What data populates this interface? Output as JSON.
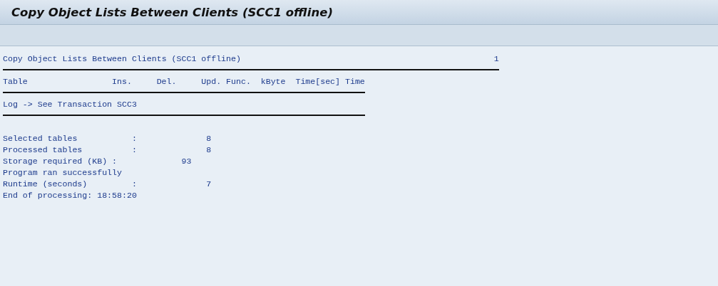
{
  "window": {
    "title": "Copy Object Lists Between Clients (SCC1 offline)"
  },
  "report": {
    "title": "Copy Object Lists Between Clients (SCC1 offline)",
    "page": "1",
    "columns": [
      "Table",
      "Ins.",
      "Del.",
      "Upd.",
      "Func.",
      "kByte",
      "Time[sec]",
      "Time"
    ],
    "log_note": "Log -> See Transaction SCC3",
    "lines": [
      {
        "kind": "stat",
        "label": "Selected tables",
        "colon": ":",
        "value": "8"
      },
      {
        "kind": "stat",
        "label": "Processed tables",
        "colon": ":",
        "value": "8"
      },
      {
        "kind": "storage",
        "label": "Storage required (KB)",
        "colon": ":",
        "value": "93"
      },
      {
        "kind": "message",
        "label": "Program ran successfully"
      },
      {
        "kind": "stat",
        "label": "Runtime (seconds)",
        "colon": ":",
        "value": "7"
      },
      {
        "kind": "message",
        "label": "End of processing: 18:58:20"
      }
    ]
  }
}
